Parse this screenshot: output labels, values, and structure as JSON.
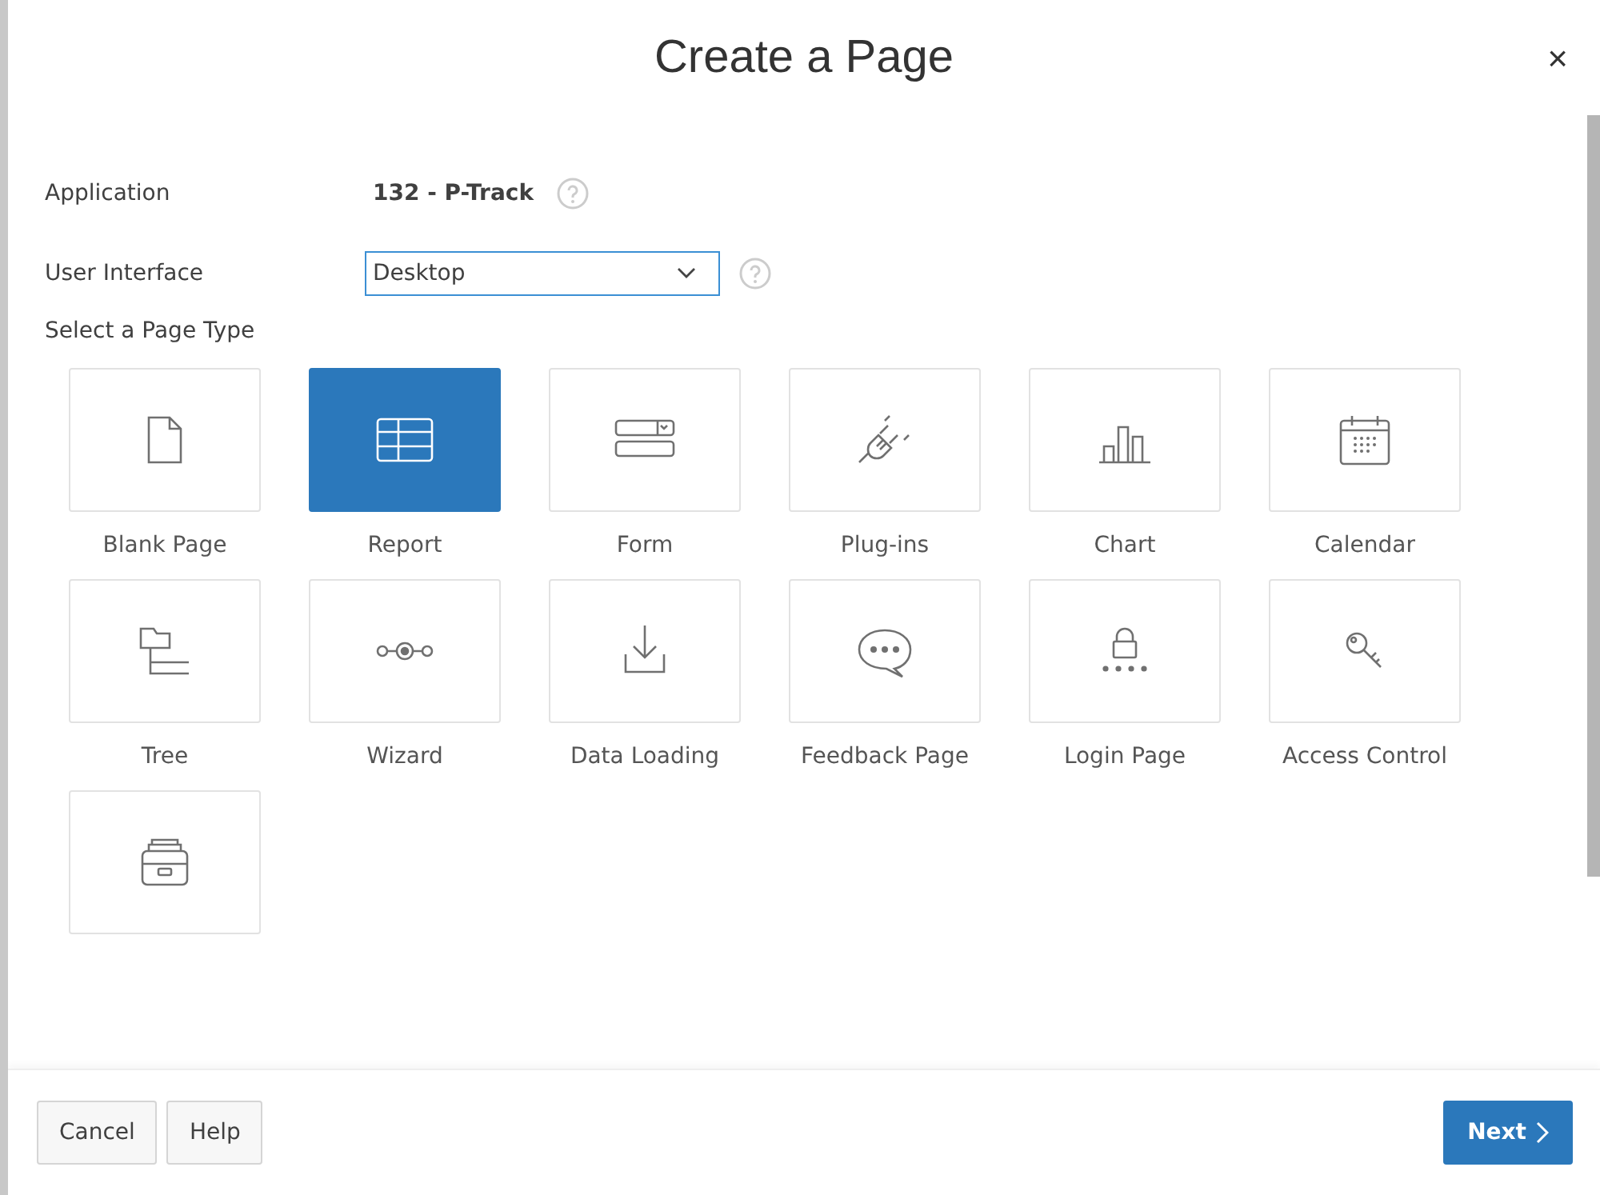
{
  "dialog": {
    "title": "Create a Page",
    "close": "×"
  },
  "fields": [
    {
      "label": "Application",
      "kind": "text",
      "value": "132 - P-Track"
    },
    {
      "label": "User Interface",
      "kind": "select",
      "value": "Desktop"
    }
  ],
  "page_types": {
    "heading": "Select a Page Type",
    "tiles": [
      {
        "kind": "blank",
        "label": "Blank Page",
        "selected": false
      },
      {
        "kind": "report",
        "label": "Report",
        "selected": true
      },
      {
        "kind": "form",
        "label": "Form",
        "selected": false
      },
      {
        "kind": "plugin",
        "label": "Plug-ins",
        "selected": false
      },
      {
        "kind": "chart",
        "label": "Chart",
        "selected": false
      },
      {
        "kind": "calendar",
        "label": "Calendar",
        "selected": false
      },
      {
        "kind": "tree",
        "label": "Tree",
        "selected": false
      },
      {
        "kind": "wizard",
        "label": "Wizard",
        "selected": false
      },
      {
        "kind": "upload",
        "label": "Data Loading",
        "selected": false
      },
      {
        "kind": "feedback",
        "label": "Feedback Page",
        "selected": false
      },
      {
        "kind": "login",
        "label": "Login Page",
        "selected": false
      },
      {
        "kind": "access",
        "label": "Access Control",
        "selected": false
      },
      {
        "kind": "archive",
        "selected": false
      }
    ]
  },
  "footer": {
    "buttons": [
      {
        "label": "Cancel",
        "kind": "secondary"
      },
      {
        "label": "Help",
        "kind": "secondary"
      },
      {
        "label": "Next",
        "kind": "primary"
      }
    ]
  }
}
